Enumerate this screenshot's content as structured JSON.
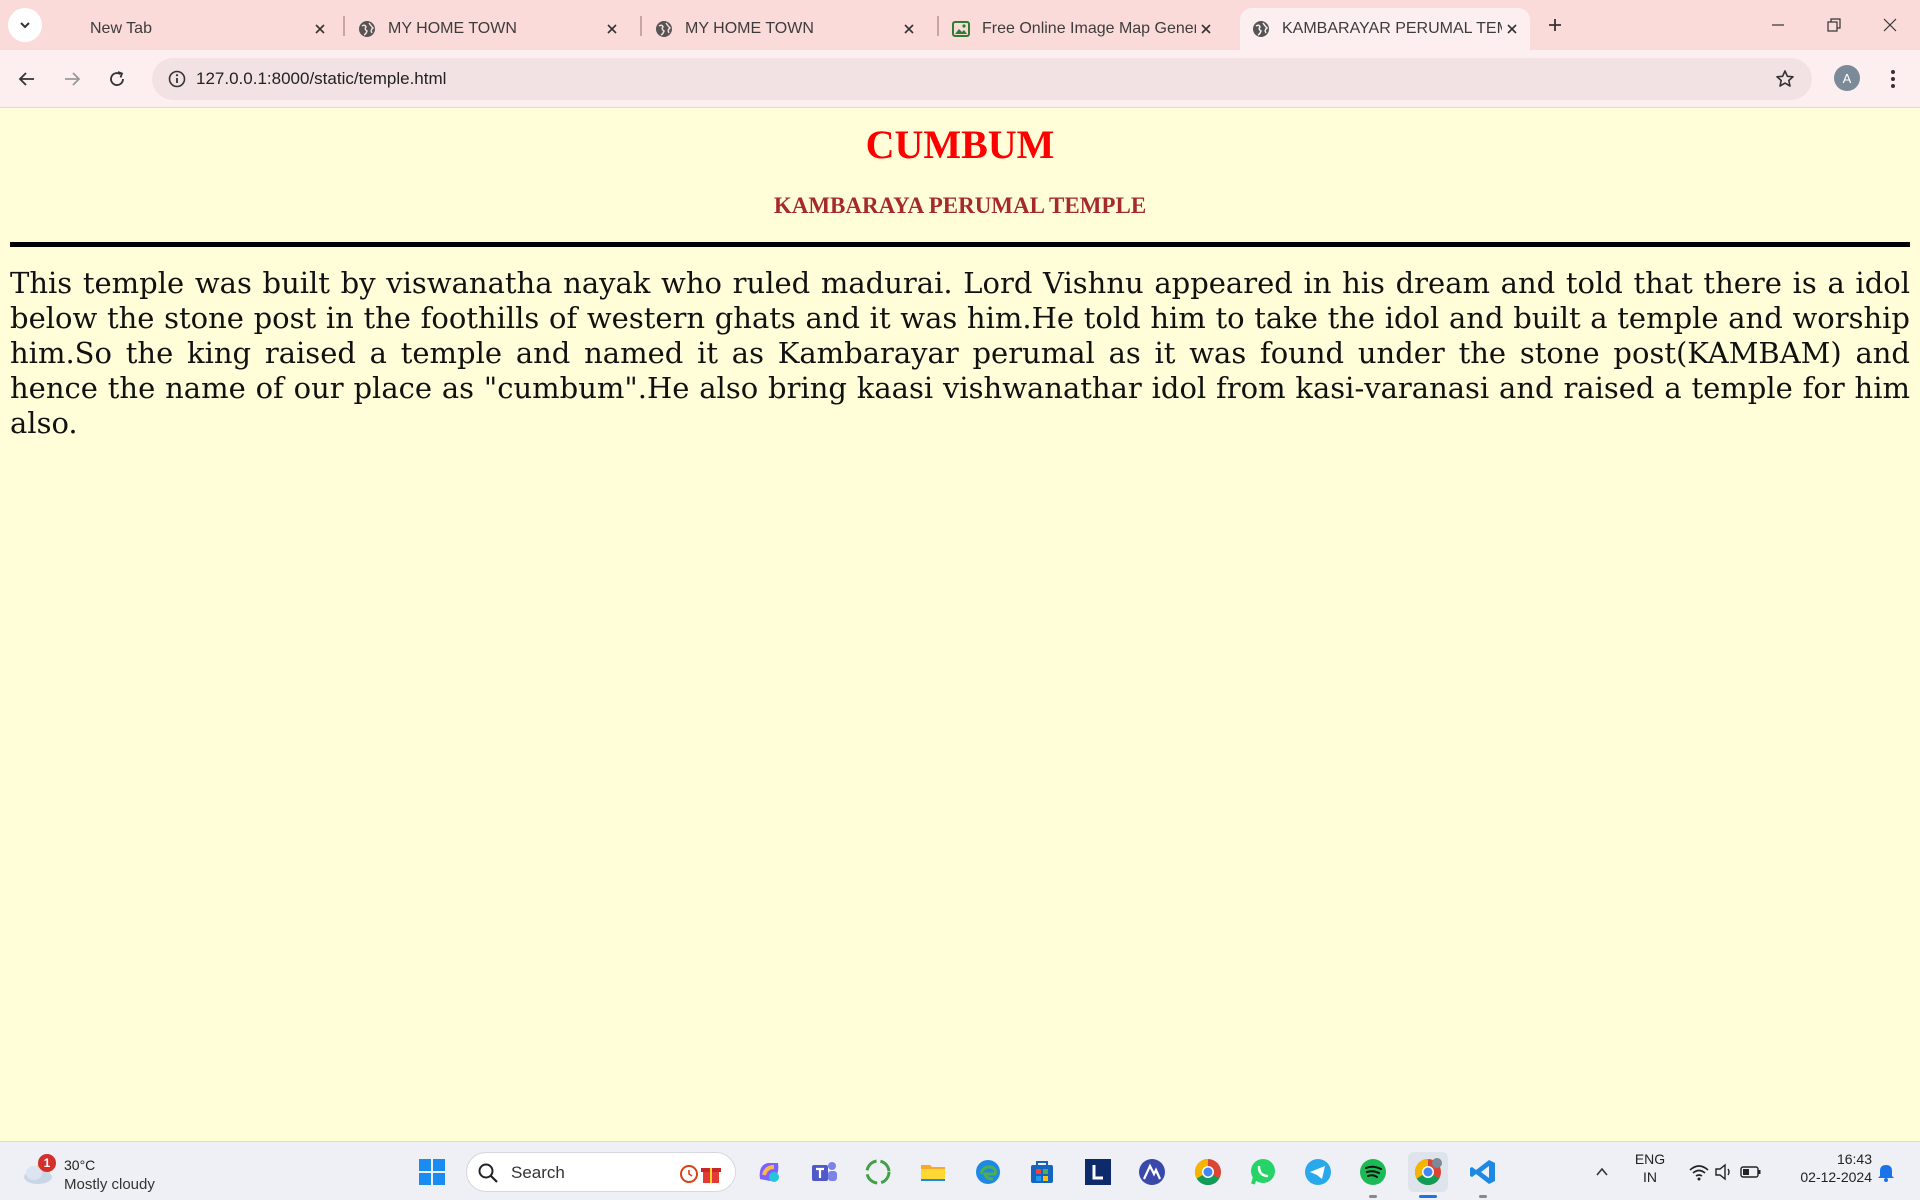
{
  "browser": {
    "tabs": [
      {
        "title": "New Tab",
        "active": false
      },
      {
        "title": "MY HOME TOWN",
        "active": false
      },
      {
        "title": "MY HOME TOWN",
        "active": false
      },
      {
        "title": "Free Online Image Map Genera",
        "active": false
      },
      {
        "title": "KAMBARAYAR PERUMAL TEMPL",
        "active": true
      }
    ],
    "url": "127.0.0.1:8000/static/temple.html",
    "profile_initial": "A"
  },
  "page": {
    "heading": "CUMBUM",
    "subheading": "KAMBARAYA PERUMAL TEMPLE",
    "paragraph": "This temple was built by viswanatha nayak who ruled madurai. Lord Vishnu appeared in his dream and told that there is a idol below the stone post in the foothills of western ghats and it was him.He told him to take the idol and built a temple and worship him.So the king raised a temple and named it as Kambarayar perumal as it was found under the stone post(KAMBAM) and hence the name of our place as \"cumbum\".He also bring kaasi vishwanathar idol from kasi-varanasi and raised a temple for him also.",
    "colors": {
      "heading": "#ff0000",
      "subheading": "#a52a2a",
      "background": "#fffed9"
    }
  },
  "taskbar": {
    "weather": {
      "badge": "1",
      "temp": "30°C",
      "condition": "Mostly cloudy"
    },
    "search_label": "Search",
    "tray": {
      "lang_line1": "ENG",
      "lang_line2": "IN",
      "time": "16:43",
      "date": "02-12-2024"
    }
  }
}
